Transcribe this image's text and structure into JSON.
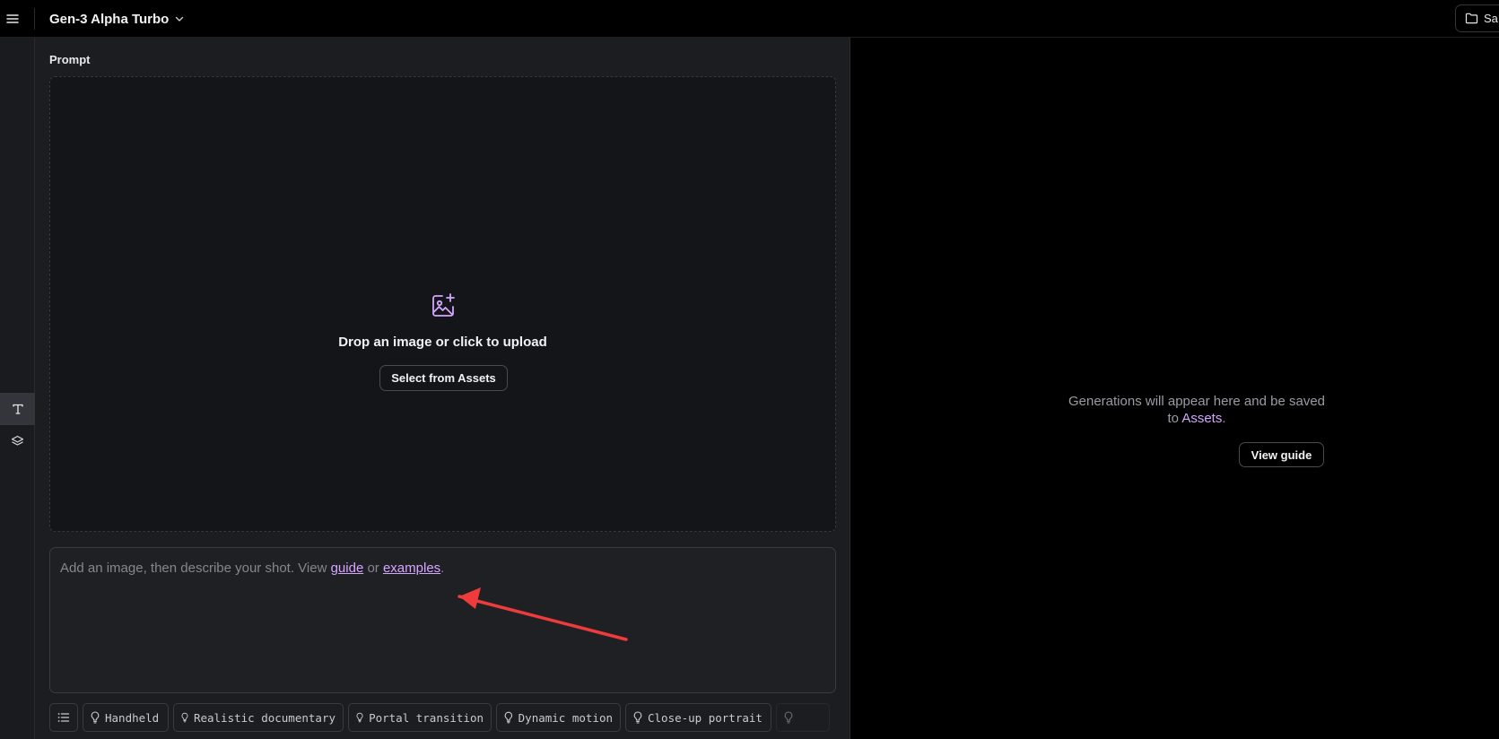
{
  "header": {
    "model_name": "Gen-3 Alpha Turbo",
    "save_label": "Sa"
  },
  "prompt": {
    "label": "Prompt",
    "drop_text": "Drop an image or click to upload",
    "assets_button": "Select from Assets",
    "textbox": {
      "prefix": "Add an image, then describe your shot. View ",
      "guide_link": "guide",
      "middle": " or ",
      "examples_link": "examples",
      "suffix": "."
    }
  },
  "presets": [
    {
      "label": "Handheld"
    },
    {
      "label": "Realistic documentary"
    },
    {
      "label": "Portal transition"
    },
    {
      "label": "Dynamic motion"
    },
    {
      "label": "Close-up portrait"
    }
  ],
  "output": {
    "empty_prefix": "Generations will appear here and be saved to ",
    "assets_link": "Assets",
    "empty_suffix": ".",
    "guide_button": "View guide"
  },
  "colors": {
    "accent": "#d6a6ff",
    "annotation_arrow": "#ef3b3b"
  }
}
